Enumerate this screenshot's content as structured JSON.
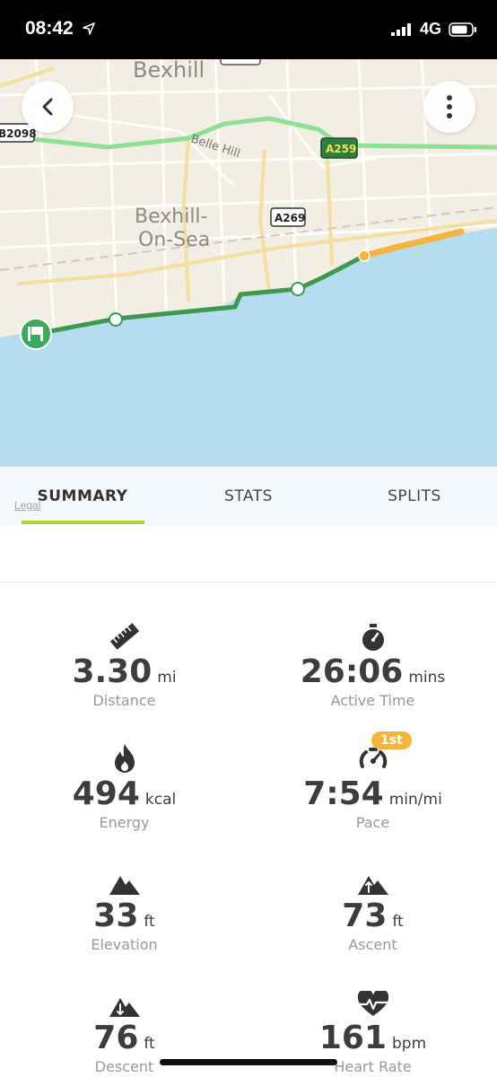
{
  "status_bar": {
    "time": "08:42",
    "network": "4G"
  },
  "map": {
    "place_labels": [
      "Bexhill",
      "Bexhill-",
      "On-Sea",
      "Belle Hill"
    ],
    "road_labels": [
      "B2098",
      "A259",
      "A269"
    ],
    "legal_text": "Legal",
    "colors": {
      "sea": "#b6dcef",
      "land": "#f2eee3",
      "route": "#3b9a4f",
      "route_end": "#f2b640",
      "main_road": "#8fe095"
    }
  },
  "tabs": [
    {
      "label": "SUMMARY",
      "active": true
    },
    {
      "label": "STATS",
      "active": false
    },
    {
      "label": "SPLITS",
      "active": false
    }
  ],
  "stats": [
    {
      "value": "3.30",
      "unit": "mi",
      "label": "Distance",
      "icon": "ruler-icon"
    },
    {
      "value": "26:06",
      "unit": "mins",
      "label": "Active Time",
      "icon": "stopwatch-icon"
    },
    {
      "value": "494",
      "unit": "kcal",
      "label": "Energy",
      "icon": "flame-icon"
    },
    {
      "value": "7:54",
      "unit": "min/mi",
      "label": "Pace",
      "icon": "speedometer-icon",
      "badge": "1st"
    },
    {
      "value": "33",
      "unit": "ft",
      "label": "Elevation",
      "icon": "mountain-icon"
    },
    {
      "value": "73",
      "unit": "ft",
      "label": "Ascent",
      "icon": "ascent-icon"
    },
    {
      "value": "76",
      "unit": "ft",
      "label": "Descent",
      "icon": "descent-icon"
    },
    {
      "value": "161",
      "unit": "bpm",
      "label": "Heart Rate",
      "icon": "heart-rate-icon"
    }
  ]
}
